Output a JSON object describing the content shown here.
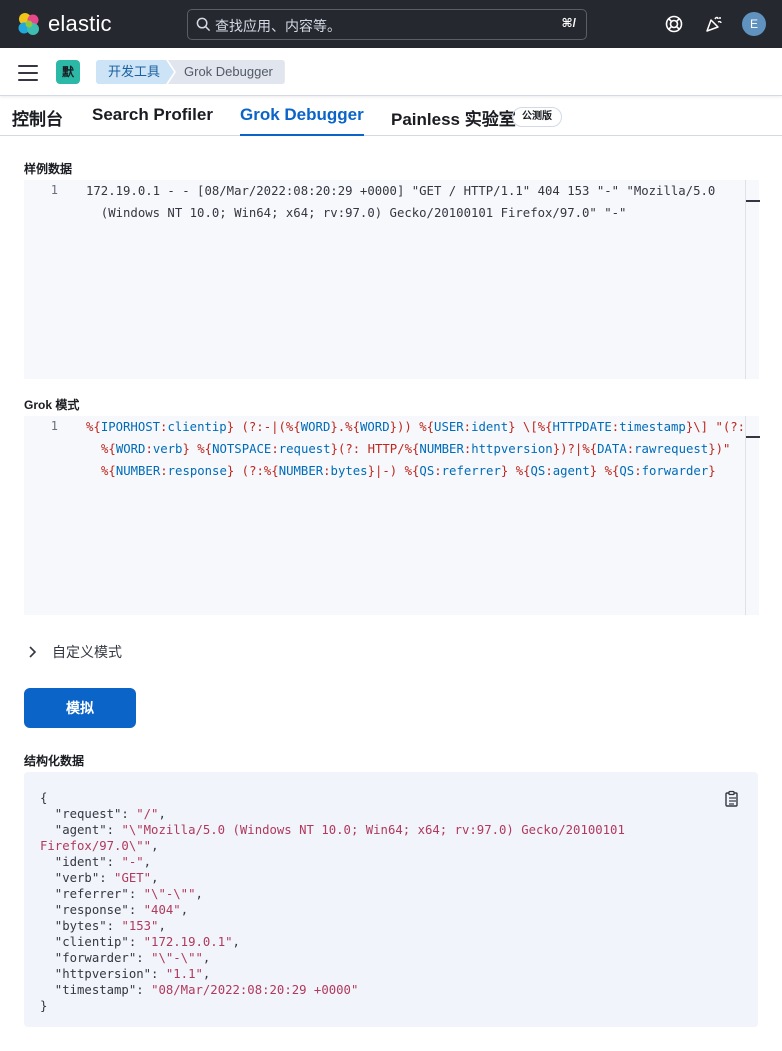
{
  "header": {
    "brand": "elastic",
    "search_placeholder": "查找应用、内容等。",
    "search_shortcut": "⌘/",
    "avatar_initial": "E"
  },
  "breadcrumbs": {
    "app_badge": "默",
    "items": [
      "开发工具",
      "Grok Debugger"
    ]
  },
  "tabs": [
    {
      "label": "控制台"
    },
    {
      "label": "Search Profiler"
    },
    {
      "label": "Grok Debugger",
      "active": true
    },
    {
      "label": "Painless 实验室"
    }
  ],
  "beta_badge": "公测版",
  "sample": {
    "label": "样例数据",
    "line_number": "1",
    "lines": [
      "172.19.0.1 - - [08/Mar/2022:08:20:29 +0000] \"GET / HTTP/1.1\" 404 153 \"-\" \"Mozilla/5.0",
      "  (Windows NT 10.0; Win64; x64; rv:97.0) Gecko/20100101 Firefox/97.0\" \"-\""
    ]
  },
  "grok": {
    "label": "Grok 模式",
    "line_number": "1",
    "pattern": "%{IPORHOST:clientip} (?:-|(%{WORD}.%{WORD})) %{USER:ident} \\[%{HTTPDATE:timestamp}\\] \"(?:%{WORD:verb} %{NOTSPACE:request}(?: HTTP/%{NUMBER:httpversion})?|%{DATA:rawrequest})\" %{NUMBER:response} (?:%{NUMBER:bytes}|-) %{QS:referrer} %{QS:agent} %{QS:forwarder}"
  },
  "custom_patterns": {
    "label": "自定义模式"
  },
  "simulate_button": "模拟",
  "output": {
    "label": "结构化数据",
    "fields": [
      {
        "key": "request",
        "value": "/"
      },
      {
        "key": "agent",
        "value": "\\\"Mozilla/5.0 (Windows NT 10.0; Win64; x64; rv:97.0) Gecko/20100101 Firefox/97.0\\\""
      },
      {
        "key": "ident",
        "value": "-"
      },
      {
        "key": "verb",
        "value": "GET"
      },
      {
        "key": "referrer",
        "value": "\\\"-\\\""
      },
      {
        "key": "response",
        "value": "404"
      },
      {
        "key": "bytes",
        "value": "153"
      },
      {
        "key": "clientip",
        "value": "172.19.0.1"
      },
      {
        "key": "forwarder",
        "value": "\\\"-\\\""
      },
      {
        "key": "httpversion",
        "value": "1.1"
      },
      {
        "key": "timestamp",
        "value": "08/Mar/2022:08:20:29 +0000"
      }
    ]
  }
}
